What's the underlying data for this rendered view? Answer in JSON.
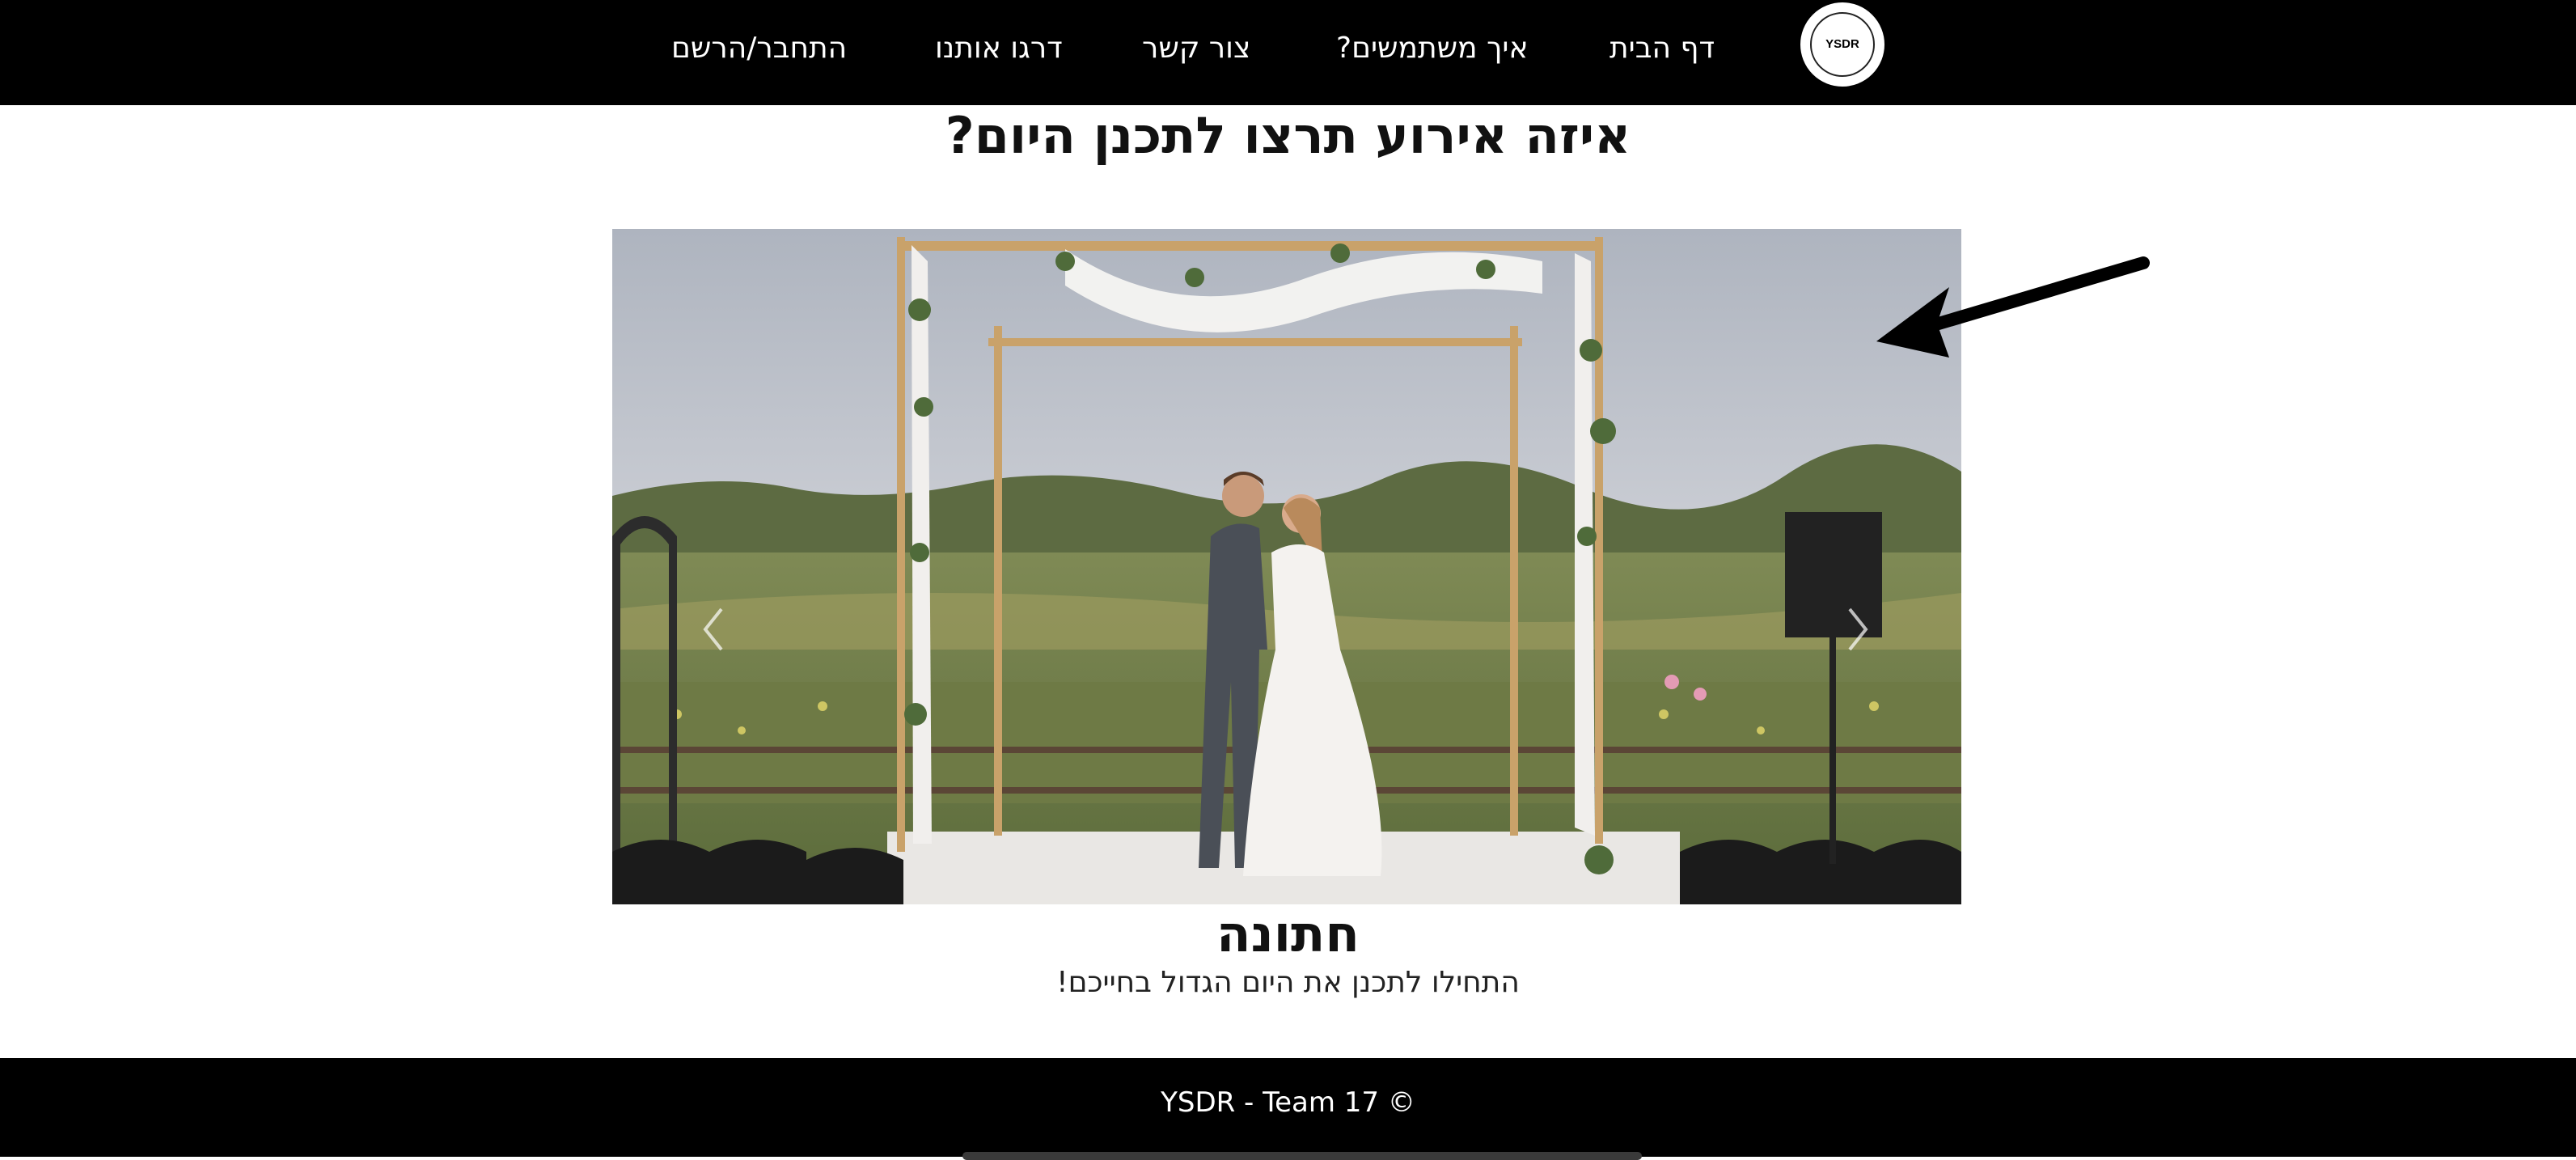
{
  "nav": {
    "logo_text": "YSDR",
    "links": [
      {
        "label": "דף הבית"
      },
      {
        "label": "איך משתמשים?"
      },
      {
        "label": "צור קשר"
      },
      {
        "label": "דרגו אותנו"
      },
      {
        "label": "התחבר/הרשם"
      }
    ]
  },
  "main": {
    "title": "איזה אירוע תרצו לתכנן היום?",
    "carousel": {
      "slide_title": "חתונה",
      "slide_text": "התחילו לתכנן את היום הגדול בחייכם!",
      "prev_icon": "chevron-left-icon",
      "next_icon": "chevron-right-icon"
    }
  },
  "footer": {
    "text": "YSDR - Team 17 ©"
  },
  "colors": {
    "nav_bg": "#000000",
    "footer_bg": "#000000",
    "text": "#111111"
  }
}
